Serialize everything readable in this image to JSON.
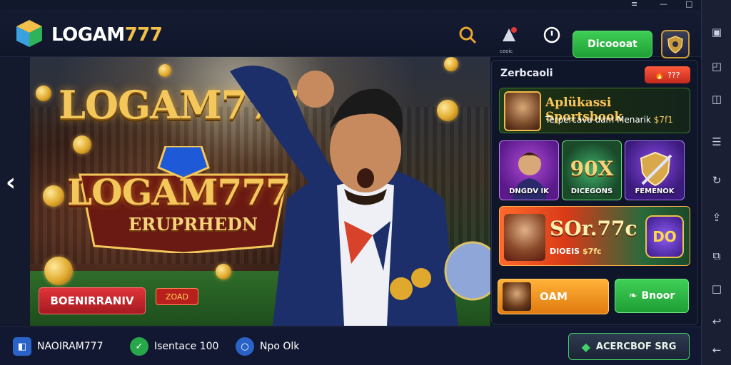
{
  "header": {
    "brand": "LOGAM777",
    "brand_plain": "LOGAM",
    "brand_gold": "777",
    "notify_sub": "ceoic",
    "deposit_label": "Dicoooat"
  },
  "hero": {
    "title1": "LOGAM777",
    "title2": "LOGAM777",
    "subtitle": "ERUPRHEDN",
    "red_button": "BOENIRRANIV",
    "tag": "ZOAD"
  },
  "panel": {
    "title": "Zerbcaoli",
    "pill_label": "??? ",
    "promo1": {
      "title": "Aplükassi Sportsbook",
      "subtitle": "Terpercava dam Menarik",
      "amount": "$7f1"
    },
    "tiles": [
      {
        "label": "DNGDV IK",
        "big": ""
      },
      {
        "label": "DICEGONS",
        "big": "90X"
      },
      {
        "label": "FEMENOK",
        "big": ""
      }
    ],
    "promo2": {
      "big": "SOr.77c",
      "subtitle": "DIOEIS",
      "amount": "$7fc",
      "shield": "DO"
    },
    "orange_button": "OAM",
    "green_button": "Bnoor"
  },
  "bottom": {
    "item1": "NAOIRAM777",
    "item2": "Isentace 100",
    "item3": "Npo Olk",
    "cta": "ACERCBOF SRG"
  },
  "colors": {
    "gold": "#f4c75b",
    "green": "#3fcf56",
    "red": "#e0343a",
    "panel_bg": "#10162a"
  }
}
